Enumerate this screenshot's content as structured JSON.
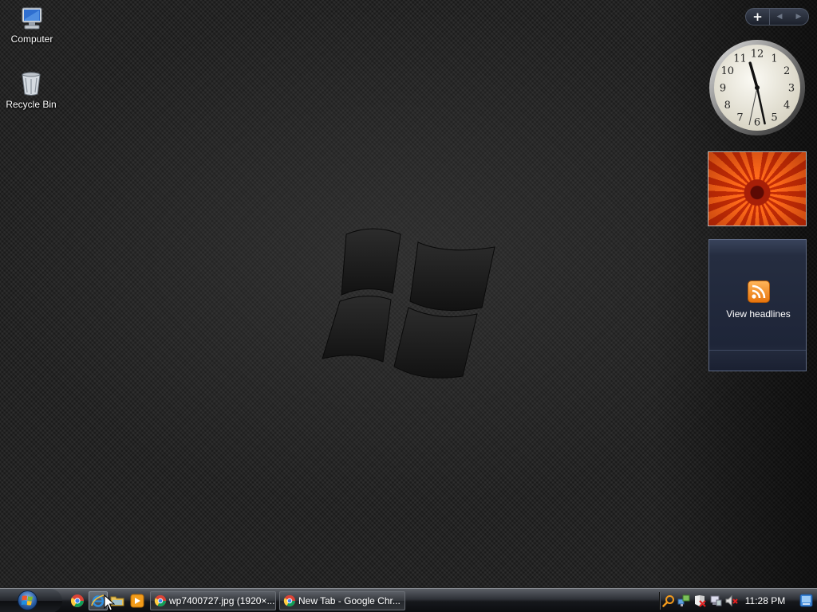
{
  "desktop": {
    "icons": [
      {
        "label": "Computer",
        "icon": "computer-icon"
      },
      {
        "label": "Recycle Bin",
        "icon": "recycle-bin-icon"
      }
    ]
  },
  "sidebar": {
    "add_gadget_label": "+",
    "gadgets": {
      "clock": {
        "hour": 11,
        "minute": 28,
        "second": 32
      },
      "slideshow": {
        "subject": "orange flower"
      },
      "feeds": {
        "button_label": "View headlines",
        "icon": "rss-icon"
      }
    }
  },
  "taskbar": {
    "quick_launch": [
      "chrome-icon",
      "internet-explorer-icon",
      "windows-explorer-icon",
      "media-player-icon"
    ],
    "tasks": [
      {
        "label": "wp7400727.jpg (1920×...",
        "icon": "chrome-icon"
      },
      {
        "label": "New Tab - Google Chr...",
        "icon": "chrome-icon"
      }
    ],
    "tray_icons": [
      "search-icon",
      "network-icon",
      "security-alert-icon",
      "network-connection-icon",
      "volume-muted-icon"
    ],
    "clock": "11:28 PM",
    "show_desktop_icon": "show-desktop-icon"
  },
  "colors": {
    "desktop_bg": "#1e1e1e",
    "flower": "#e8500c",
    "rss": "#f39a2c",
    "feed_gadget": "#232a3c"
  }
}
